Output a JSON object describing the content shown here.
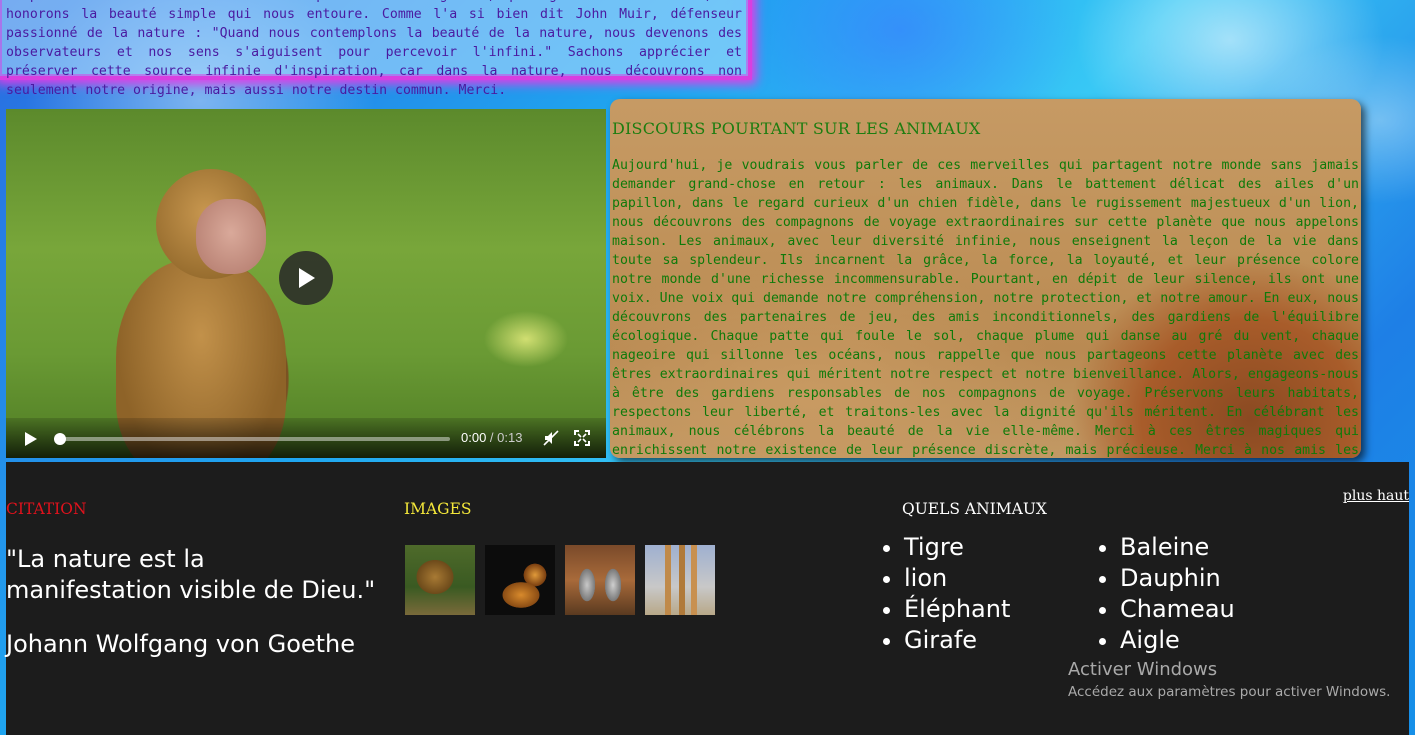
{
  "intro": {
    "text": "responsabilité envers la nature. Respectons sa fragilité, protégeons sa diversité, et honorons la beauté simple qui nous entoure. Comme l'a si bien dit John Muir, défenseur passionné de la nature : \"Quand nous contemplons la beauté de la nature, nous devenons des observateurs et nos sens s'aiguisent pour percevoir l'infini.\" Sachons apprécier et préserver cette source infinie d'inspiration, car dans la nature, nous découvrons non seulement notre origine, mais aussi notre destin commun. Merci."
  },
  "video": {
    "current_time": "0:00",
    "separator": " / ",
    "duration": "0:13",
    "progress": 0,
    "icons": [
      "play-icon",
      "mute-icon",
      "fullscreen-icon"
    ]
  },
  "speech": {
    "title": "DISCOURS POURTANT SUR LES ANIMAUX",
    "text": "Aujourd'hui, je voudrais vous parler de ces merveilles qui partagent notre monde sans jamais demander grand-chose en retour : les animaux. Dans le battement délicat des ailes d'un papillon, dans le regard curieux d'un chien fidèle, dans le rugissement majestueux d'un lion, nous découvrons des compagnons de voyage extraordinaires sur cette planète que nous appelons maison. Les animaux, avec leur diversité infinie, nous enseignent la leçon de la vie dans toute sa splendeur. Ils incarnent la grâce, la force, la loyauté, et leur présence colore notre monde d'une richesse incommensurable. Pourtant, en dépit de leur silence, ils ont une voix. Une voix qui demande notre compréhension, notre protection, et notre amour. En eux, nous découvrons des partenaires de jeu, des amis inconditionnels, des gardiens de l'équilibre écologique. Chaque patte qui foule le sol, chaque plume qui danse au gré du vent, chaque nageoire qui sillonne les océans, nous rappelle que nous partageons cette planète avec des êtres extraordinaires qui méritent notre respect et notre bienveillance. Alors, engageons-nous à être des gardiens responsables de nos compagnons de voyage. Préservons leurs habitats, respectons leur liberté, et traitons-les avec la dignité qu'ils méritent. En célébrant les animaux, nous célébrons la beauté de la vie elle-même. Merci à ces êtres magiques qui enrichissent notre existence de leur présence discrète, mais précieuse. Merci à nos amis les animaux."
  },
  "footer": {
    "citation_title": "CITATION",
    "quote": "\"La nature est la manifestation visible de Dieu.\"",
    "author": "Johann Wolfgang von Goethe",
    "images_title": "IMAGES",
    "animals_title": "QUELS ANIMAUX",
    "back_to_top": "plus haut",
    "animals_col1": [
      "Tigre",
      "lion",
      "Éléphant",
      "Girafe"
    ],
    "animals_col2": [
      "Baleine",
      "Dauphin",
      "Chameau",
      "Aigle"
    ],
    "colors": {
      "citation": "#e0121c",
      "images": "#f5e83a",
      "animals": "#ffffff",
      "background": "#1c1c1c"
    }
  },
  "watermark": {
    "line1": "Activer Windows",
    "line2": "Accédez aux paramètres pour activer Windows."
  }
}
